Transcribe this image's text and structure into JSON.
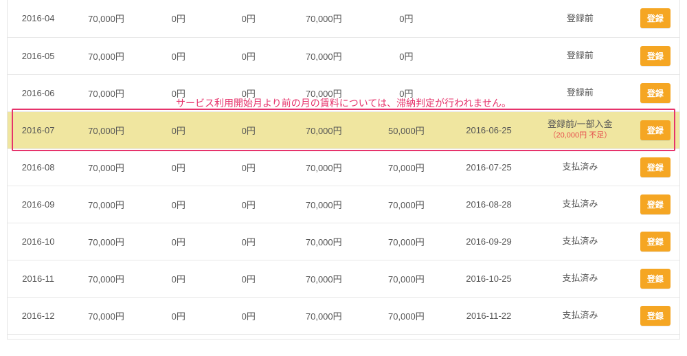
{
  "annotation": "サービス利用開始月より前の月の賃料については、滞納判定が行われません。",
  "button_label": "登録",
  "highlight_index": 3,
  "rows": [
    {
      "month": "2016-04",
      "a": "70,000円",
      "b": "0円",
      "c": "0円",
      "d": "70,000円",
      "e": "0円",
      "date": "",
      "status": "登録前",
      "sub": ""
    },
    {
      "month": "2016-05",
      "a": "70,000円",
      "b": "0円",
      "c": "0円",
      "d": "70,000円",
      "e": "0円",
      "date": "",
      "status": "登録前",
      "sub": ""
    },
    {
      "month": "2016-06",
      "a": "70,000円",
      "b": "0円",
      "c": "0円",
      "d": "70,000円",
      "e": "0円",
      "date": "",
      "status": "登録前",
      "sub": ""
    },
    {
      "month": "2016-07",
      "a": "70,000円",
      "b": "0円",
      "c": "0円",
      "d": "70,000円",
      "e": "50,000円",
      "date": "2016-06-25",
      "status": "登録前/一部入金",
      "sub": "（20,000円 不足）"
    },
    {
      "month": "2016-08",
      "a": "70,000円",
      "b": "0円",
      "c": "0円",
      "d": "70,000円",
      "e": "70,000円",
      "date": "2016-07-25",
      "status": "支払済み",
      "sub": ""
    },
    {
      "month": "2016-09",
      "a": "70,000円",
      "b": "0円",
      "c": "0円",
      "d": "70,000円",
      "e": "70,000円",
      "date": "2016-08-28",
      "status": "支払済み",
      "sub": ""
    },
    {
      "month": "2016-10",
      "a": "70,000円",
      "b": "0円",
      "c": "0円",
      "d": "70,000円",
      "e": "70,000円",
      "date": "2016-09-29",
      "status": "支払済み",
      "sub": ""
    },
    {
      "month": "2016-11",
      "a": "70,000円",
      "b": "0円",
      "c": "0円",
      "d": "70,000円",
      "e": "70,000円",
      "date": "2016-10-25",
      "status": "支払済み",
      "sub": ""
    },
    {
      "month": "2016-12",
      "a": "70,000円",
      "b": "0円",
      "c": "0円",
      "d": "70,000円",
      "e": "70,000円",
      "date": "2016-11-22",
      "status": "支払済み",
      "sub": ""
    }
  ]
}
